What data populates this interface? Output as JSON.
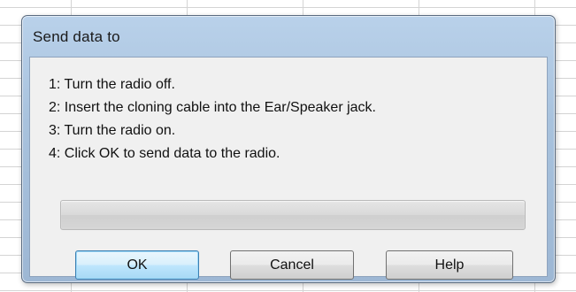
{
  "dialog": {
    "title": "Send data to",
    "steps": [
      "1: Turn the radio off.",
      "2: Insert the cloning cable into the Ear/Speaker jack.",
      "3: Turn the radio on.",
      "4: Click OK to send data to the radio."
    ],
    "progress_percent": 0,
    "buttons": {
      "ok": "OK",
      "cancel": "Cancel",
      "help": "Help"
    }
  },
  "colors": {
    "frame": "#a8c2dd",
    "client": "#f0f0f0",
    "default_button_border": "#3c7fb1"
  }
}
